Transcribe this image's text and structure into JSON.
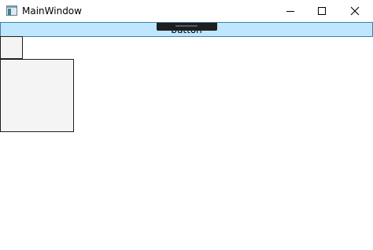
{
  "window": {
    "title": "MainWindow",
    "icon": "app-window-icon",
    "controls": {
      "minimize_icon": "minimize-icon",
      "maximize_icon": "maximize-icon",
      "close_icon": "close-icon"
    }
  },
  "content": {
    "button_label": "button",
    "button_background": "#bee6fd",
    "button_border": "#3c7fb1"
  },
  "debug_toolbar": {
    "color": "#1e1e1e"
  }
}
